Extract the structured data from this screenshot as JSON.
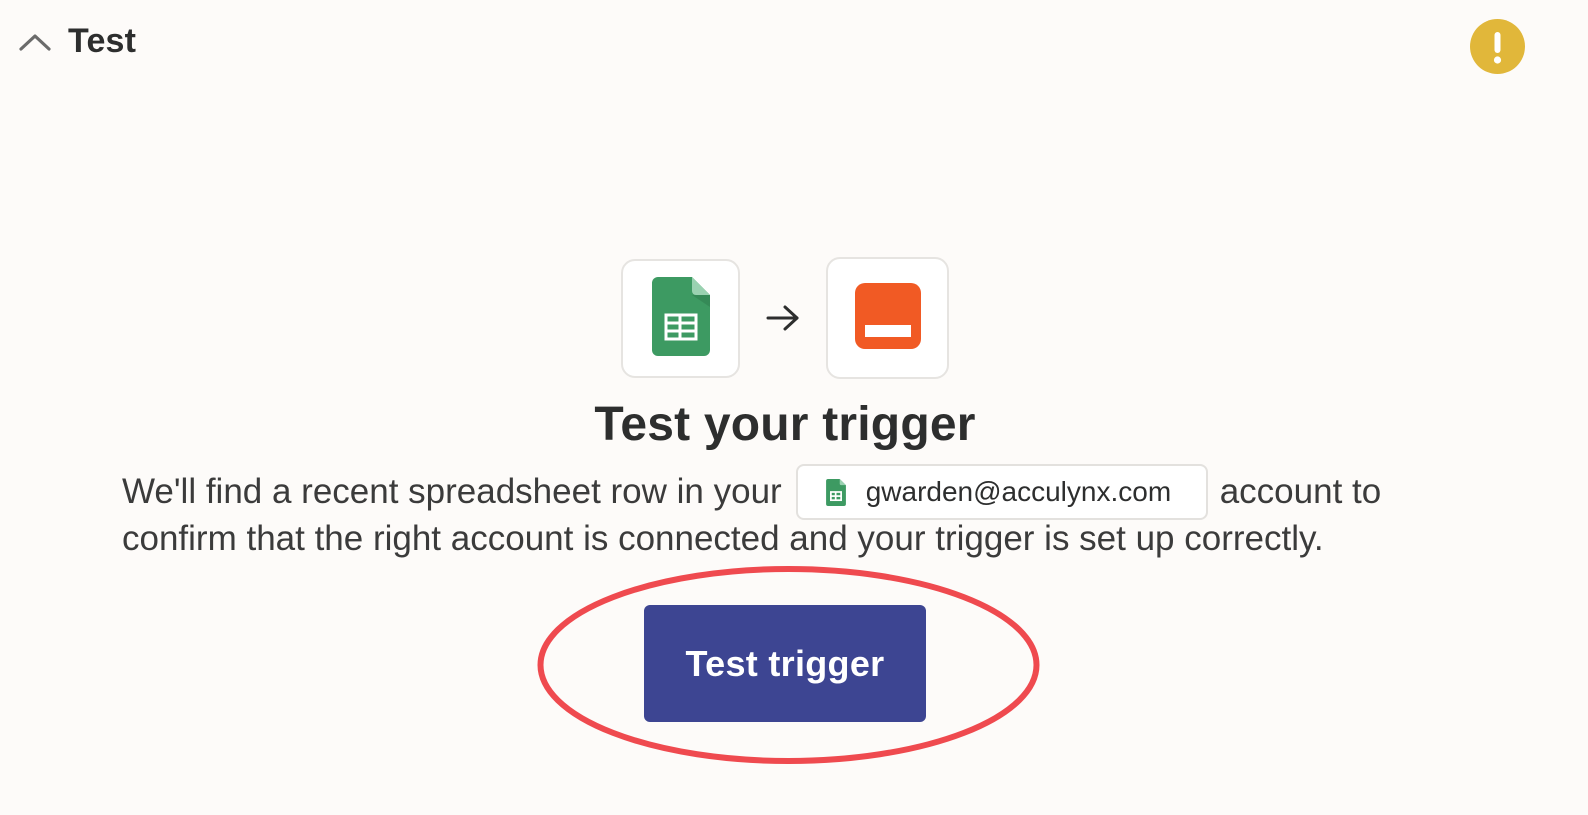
{
  "header": {
    "title": "Test",
    "collapse_icon": "chevron-up-icon",
    "status_icon": "warning-icon",
    "status_color": "#e1b73a"
  },
  "apps": {
    "trigger_icon": "google-sheets-icon",
    "action_icon": "orange-app-icon",
    "connector_icon": "arrow-right-icon",
    "trigger_color": "#34a868",
    "action_color": "#f15a24"
  },
  "main": {
    "heading": "Test your trigger",
    "description_before": "We'll find a recent spreadsheet row in your",
    "account": "gwarden@acculynx.com",
    "description_after": "account to",
    "description_line2": "confirm that the right account is connected and your trigger is set up correctly.",
    "button_label": "Test trigger",
    "button_color": "#3d4592",
    "highlight_color": "#ef4a4f"
  }
}
